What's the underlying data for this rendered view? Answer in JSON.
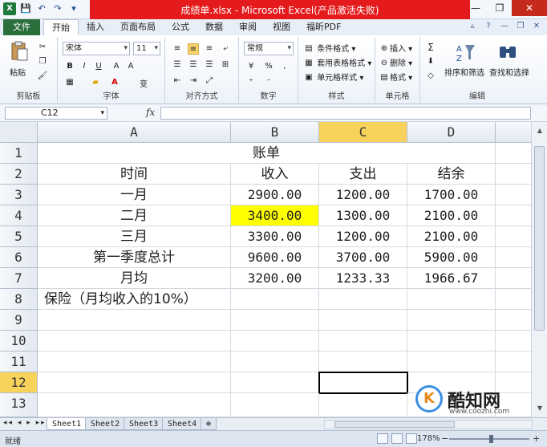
{
  "window": {
    "title": "成绩单.xlsx - Microsoft Excel(产品激活失败)",
    "controls": {
      "minimize": "—",
      "maximize": "❐",
      "close": "✕"
    }
  },
  "ribbon": {
    "tabs": [
      "文件",
      "开始",
      "插入",
      "页面布局",
      "公式",
      "数据",
      "审阅",
      "视图",
      "福昕PDF"
    ],
    "active_tab": "开始",
    "clipboard": {
      "paste": "粘贴",
      "label": "剪贴板"
    },
    "font": {
      "name": "宋体",
      "size": "11",
      "bold": "B",
      "italic": "I",
      "underline": "U",
      "label": "字体",
      "wen": "变"
    },
    "alignment": {
      "label": "对齐方式"
    },
    "number": {
      "format": "常规",
      "label": "数字",
      "percent": "%",
      "comma": ","
    },
    "styles": {
      "conditional": "条件格式",
      "table": "套用表格格式",
      "cell": "单元格样式",
      "label": "样式"
    },
    "cells": {
      "insert": "插入",
      "delete": "删除",
      "format": "格式",
      "label": "单元格"
    },
    "editing": {
      "sort": "排序和筛选",
      "find": "查找和选择",
      "label": "编辑",
      "sigma": "Σ"
    }
  },
  "formula_bar": {
    "name_box": "C12",
    "fx": "fx",
    "value": ""
  },
  "columns": [
    "A",
    "B",
    "C",
    "D"
  ],
  "rows": [
    "1",
    "2",
    "3",
    "4",
    "5",
    "6",
    "7",
    "8",
    "9",
    "10",
    "11",
    "12",
    "13"
  ],
  "cells": {
    "title": "账单",
    "headers": [
      "时间",
      "收入",
      "支出",
      "结余"
    ],
    "data": [
      [
        "一月",
        "2900.00",
        "1200.00",
        "1700.00"
      ],
      [
        "二月",
        "3400.00",
        "1300.00",
        "2100.00"
      ],
      [
        "三月",
        "3300.00",
        "1200.00",
        "2100.00"
      ],
      [
        "第一季度总计",
        "9600.00",
        "3700.00",
        "5900.00"
      ],
      [
        "月均",
        "3200.00",
        "1233.33",
        "1966.67"
      ]
    ],
    "note": "保险（月均收入的10%）"
  },
  "sheets": [
    "Sheet1",
    "Sheet2",
    "Sheet3",
    "Sheet4"
  ],
  "active_sheet": "Sheet1",
  "status": {
    "ready": "就绪",
    "zoom": "178%"
  },
  "watermark": {
    "text": "酷知网",
    "url": "www.coozhi.com",
    "letter": "K"
  },
  "colors": {
    "highlight": "#ffff00",
    "selected_header": "#f8d35c",
    "title_band": "#e41a1c"
  }
}
